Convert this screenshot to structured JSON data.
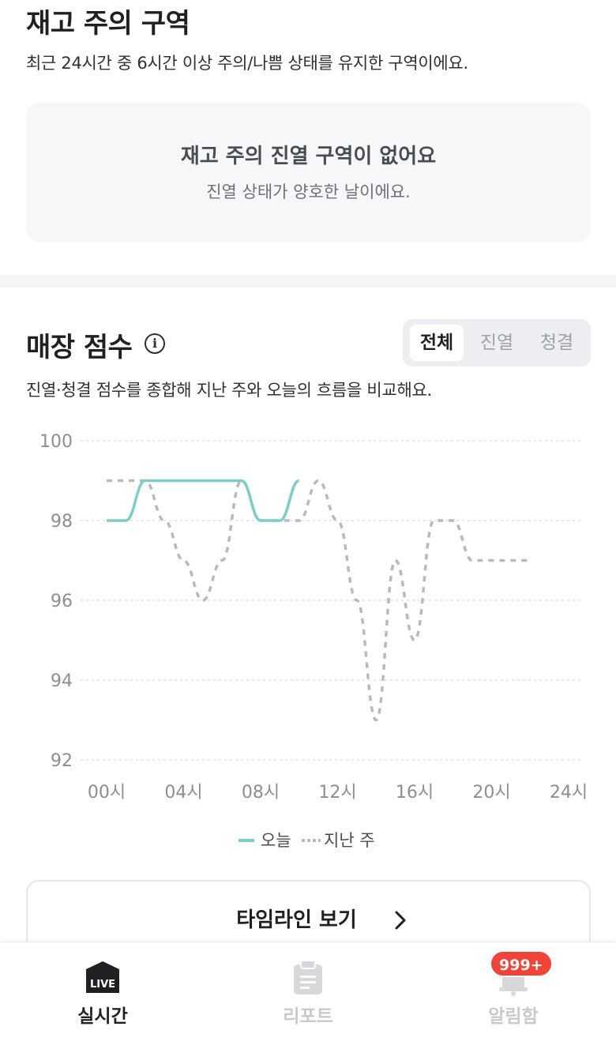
{
  "stock_alert": {
    "title": "재고 주의 구역",
    "description": "최근 24시간 중 6시간 이상 주의/나쁨 상태를 유지한 구역이에요.",
    "empty_title": "재고 주의 진열 구역이 없어요",
    "empty_subtitle": "진열 상태가 양호한 날이에요."
  },
  "store_score": {
    "title": "매장 점수",
    "info_icon": "info-circle-icon",
    "description": "진열·청결 점수를 종합해 지난 주와 오늘의 흐름을 비교해요.",
    "segments": [
      {
        "label": "전체",
        "active": true
      },
      {
        "label": "진열",
        "active": false
      },
      {
        "label": "청결",
        "active": false
      }
    ],
    "timeline_button": "타임라인 보기"
  },
  "chart_data": {
    "type": "line",
    "title": "",
    "xlabel": "",
    "ylabel": "",
    "x_ticks": [
      "00시",
      "04시",
      "08시",
      "12시",
      "16시",
      "20시",
      "24시"
    ],
    "y_ticks": [
      "92",
      "94",
      "96",
      "98",
      "100"
    ],
    "xlim": [
      0,
      24
    ],
    "ylim": [
      92,
      100
    ],
    "grid": "horizontal dotted",
    "legend_position": "bottom-center",
    "series": [
      {
        "name": "오늘",
        "color": "#7ecdc9",
        "style": "solid",
        "x": [
          0,
          1,
          2,
          3,
          4,
          5,
          6,
          7,
          8,
          9,
          10
        ],
        "y": [
          98,
          98,
          99,
          99,
          99,
          99,
          99,
          99,
          98,
          98,
          99
        ]
      },
      {
        "name": "지난 주",
        "color": "#b7b9be",
        "style": "dashed",
        "x": [
          0,
          1,
          2,
          3,
          4,
          5,
          6,
          7,
          8,
          9,
          10,
          11,
          12,
          13,
          14,
          15,
          16,
          17,
          18,
          19,
          20,
          21,
          22
        ],
        "y": [
          99,
          99,
          99,
          98,
          97,
          96,
          97,
          99,
          98,
          98,
          98,
          99,
          98,
          96,
          93,
          97,
          95,
          98,
          98,
          97,
          97,
          97,
          97
        ]
      }
    ]
  },
  "tabbar": {
    "tabs": [
      {
        "label": "실시간",
        "icon": "live-icon",
        "active": true
      },
      {
        "label": "리포트",
        "icon": "clipboard-icon",
        "active": false
      },
      {
        "label": "알림함",
        "icon": "bell-icon",
        "active": false
      }
    ],
    "live_icon_text": "LIVE",
    "badge": "999+"
  },
  "colors": {
    "accent_today": "#7ecdc9",
    "last_week": "#b7b9be",
    "badge": "#f04438"
  }
}
